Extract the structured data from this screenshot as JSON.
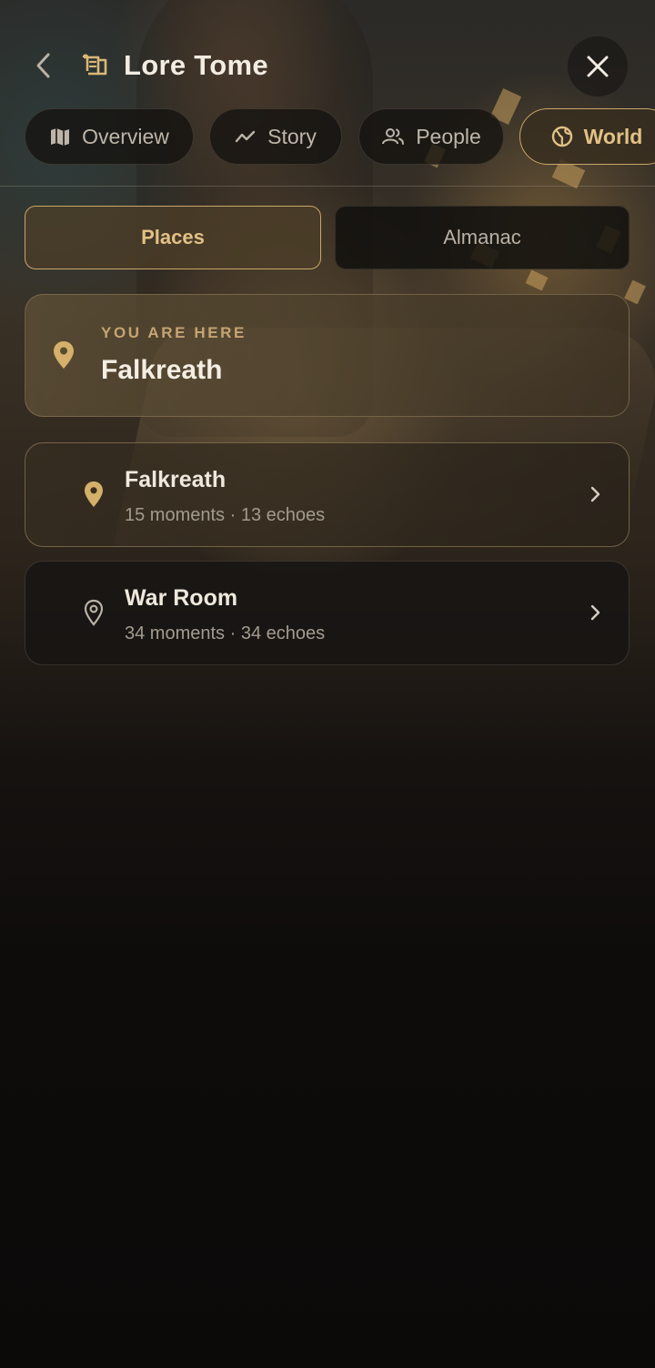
{
  "header": {
    "title": "Lore Tome"
  },
  "tabs": [
    {
      "label": "Overview",
      "icon": "map-book-icon",
      "active": false
    },
    {
      "label": "Story",
      "icon": "trend-line-icon",
      "active": false
    },
    {
      "label": "People",
      "icon": "people-icon",
      "active": false
    },
    {
      "label": "World",
      "icon": "globe-icon",
      "active": true
    }
  ],
  "segments": {
    "places": "Places",
    "almanac": "Almanac",
    "active": "Places"
  },
  "current_location": {
    "label": "YOU ARE HERE",
    "name": "Falkreath"
  },
  "places": [
    {
      "name": "Falkreath",
      "meta": "15 moments · 13 echoes",
      "current": true
    },
    {
      "name": "War Room",
      "meta": "34 moments · 34 echoes",
      "current": false
    }
  ],
  "colors": {
    "accent": "#c9a66a",
    "accent_text": "#e2c186",
    "background": "#0e0c0b",
    "text": "#efe8dc",
    "muted": "#a39b8e"
  }
}
